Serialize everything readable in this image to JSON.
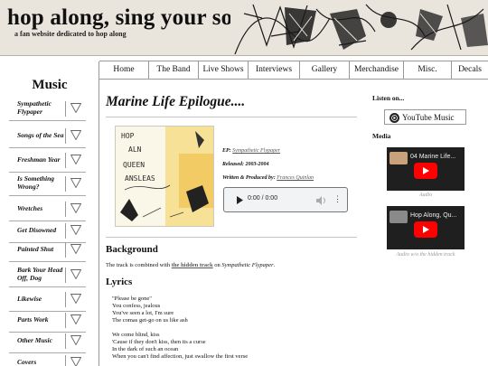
{
  "header": {
    "site_title": "hop along, sing your song",
    "site_subtitle": "a fan website dedicated to hop along"
  },
  "nav": {
    "items": [
      "Home",
      "The Band",
      "Live Shows",
      "Interviews",
      "Gallery",
      "Merchandise",
      "Misc.",
      "Decals"
    ]
  },
  "sidebar": {
    "title": "Music",
    "items": [
      "Sympathetic Flypaper",
      "Songs of the Sea",
      "Freshman Year",
      "Is Something Wrong?",
      "Wretches",
      "Get Disowned",
      "Painted Shut",
      "Bark Your Head Off, Dog",
      "Likewise",
      "Parts Work",
      "Other Music",
      "Covers"
    ]
  },
  "main": {
    "title": "Marine Life Epilogue....",
    "album_art_text": [
      "HOP",
      "ALN",
      "QUEEN",
      "ANSLEAS"
    ],
    "ep_label": "EP:",
    "ep_value": "Sympathetic Flypaper",
    "released_label": "Released:",
    "released_value": "2003-2004",
    "written_label": "Written & Produced by:",
    "written_value": "Frances Quinlan",
    "audio_time": "0:00 / 0:00",
    "background_heading": "Background",
    "background_pre": "The track is combined with",
    "background_link": "the hidden track",
    "background_mid": "on",
    "background_album": "Sympathetic Flypaper",
    "background_post": ".",
    "lyrics_heading": "Lyrics",
    "lyrics_stanzas": [
      [
        "\"Please be gone\"",
        "You confess, jealous",
        "You've seen a lot, I'm sure",
        "The comas get-go on us like ash"
      ],
      [
        "We come blind, kiss",
        "'Cause if they don't kiss, then its a curse",
        "In the dark of such an ocean",
        "When you can't find affection, just swallow the first verse"
      ],
      [
        "When your home is not a home"
      ]
    ]
  },
  "right": {
    "listen_heading": "Listen on...",
    "youtube_music_label": "YouTube Music",
    "media_heading": "Media",
    "videos": [
      {
        "title": "04 Marine Life...",
        "caption": "Audio"
      },
      {
        "title": "Hop Along, Qu...",
        "caption": "Audio w/o the hidden track"
      }
    ]
  },
  "colors": {
    "youtube_red": "#ff0000",
    "rule_gray": "#c6c6c6",
    "link_gray": "#555555",
    "banner_bg": "#e9e4dc"
  }
}
